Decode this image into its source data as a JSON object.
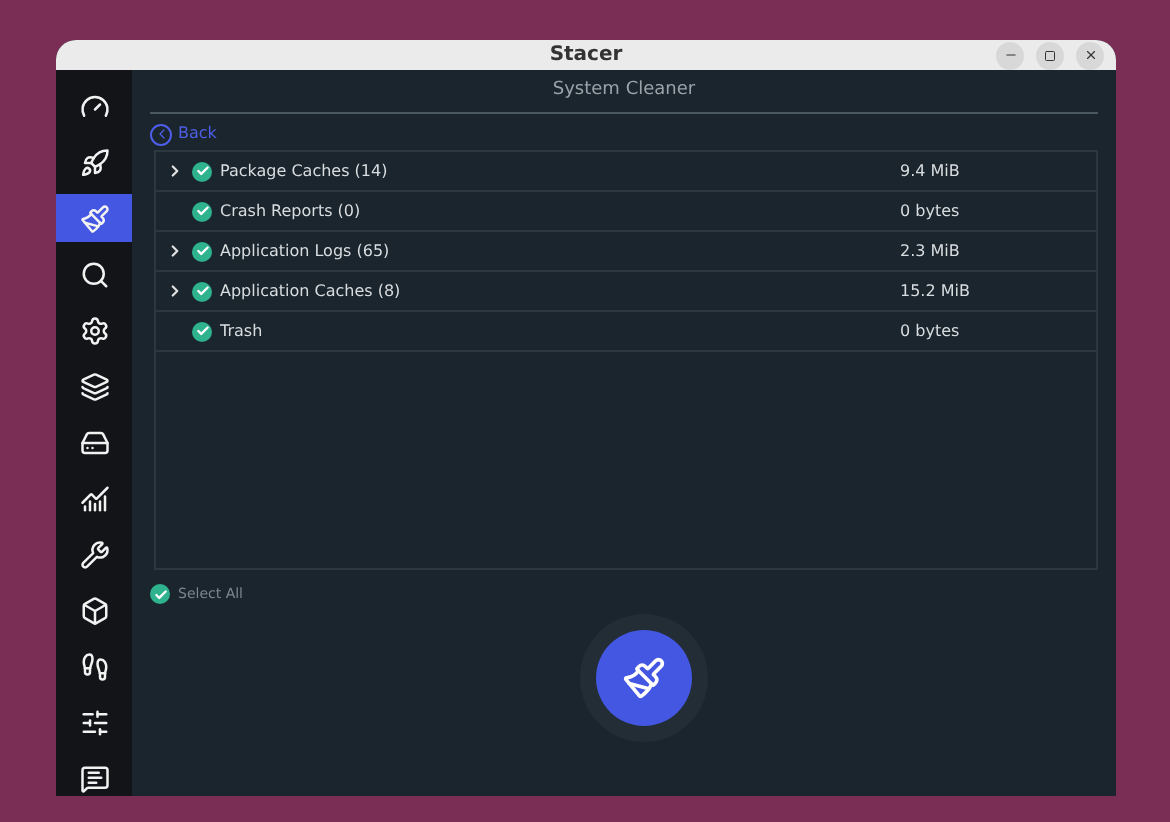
{
  "window": {
    "title": "Stacer"
  },
  "sidebar": {
    "items": [
      {
        "selected": false
      },
      {
        "selected": false
      },
      {
        "selected": true
      },
      {
        "selected": false
      },
      {
        "selected": false
      },
      {
        "selected": false
      },
      {
        "selected": false
      },
      {
        "selected": false
      },
      {
        "selected": false
      },
      {
        "selected": false
      },
      {
        "selected": false
      },
      {
        "selected": false
      },
      {
        "selected": false
      }
    ]
  },
  "page_title": "System Cleaner",
  "back_link": "Back",
  "rows": [
    {
      "label": "Package Caches (14)",
      "size": "9.4 MiB",
      "expandable": true,
      "checked": true
    },
    {
      "label": "Crash Reports (0)",
      "size": "0 bytes",
      "expandable": false,
      "checked": true
    },
    {
      "label": "Application Logs (65)",
      "size": "2.3 MiB",
      "expandable": true,
      "checked": true
    },
    {
      "label": "Application Caches (8)",
      "size": "15.2 MiB",
      "expandable": true,
      "checked": true
    },
    {
      "label": "Trash",
      "size": "0 bytes",
      "expandable": false,
      "checked": true
    }
  ],
  "select_all": {
    "label": "Select All",
    "checked": true
  }
}
